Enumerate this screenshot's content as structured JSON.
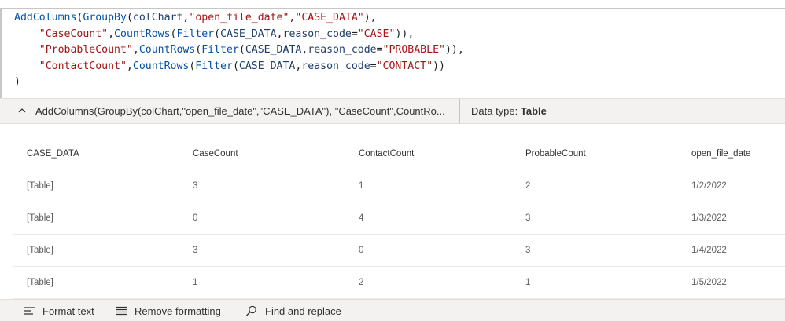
{
  "editor": {
    "lines": [
      [
        {
          "t": "AddColumns",
          "k": "fn"
        },
        {
          "t": "(",
          "k": "p"
        },
        {
          "t": "GroupBy",
          "k": "fn"
        },
        {
          "t": "(",
          "k": "p"
        },
        {
          "t": "colChart",
          "k": "id"
        },
        {
          "t": ",",
          "k": "p"
        },
        {
          "t": "\"open_file_date\"",
          "k": "str"
        },
        {
          "t": ",",
          "k": "p"
        },
        {
          "t": "\"CASE_DATA\"",
          "k": "str"
        },
        {
          "t": "),",
          "k": "p"
        }
      ],
      [
        {
          "t": "    ",
          "k": "p"
        },
        {
          "t": "\"CaseCount\"",
          "k": "str"
        },
        {
          "t": ",",
          "k": "p"
        },
        {
          "t": "CountRows",
          "k": "fn"
        },
        {
          "t": "(",
          "k": "p"
        },
        {
          "t": "Filter",
          "k": "fn"
        },
        {
          "t": "(",
          "k": "p"
        },
        {
          "t": "CASE_DATA",
          "k": "id"
        },
        {
          "t": ",",
          "k": "p"
        },
        {
          "t": "reason_code",
          "k": "id"
        },
        {
          "t": "=",
          "k": "p"
        },
        {
          "t": "\"CASE\"",
          "k": "str"
        },
        {
          "t": ")),",
          "k": "p"
        }
      ],
      [
        {
          "t": "    ",
          "k": "p"
        },
        {
          "t": "\"ProbableCount\"",
          "k": "str"
        },
        {
          "t": ",",
          "k": "p"
        },
        {
          "t": "CountRows",
          "k": "fn"
        },
        {
          "t": "(",
          "k": "p"
        },
        {
          "t": "Filter",
          "k": "fn"
        },
        {
          "t": "(",
          "k": "p"
        },
        {
          "t": "CASE_DATA",
          "k": "id"
        },
        {
          "t": ",",
          "k": "p"
        },
        {
          "t": "reason_code",
          "k": "id"
        },
        {
          "t": "=",
          "k": "p"
        },
        {
          "t": "\"PROBABLE\"",
          "k": "str"
        },
        {
          "t": ")),",
          "k": "p"
        }
      ],
      [
        {
          "t": "    ",
          "k": "p"
        },
        {
          "t": "\"ContactCount\"",
          "k": "str"
        },
        {
          "t": ",",
          "k": "p"
        },
        {
          "t": "CountRows",
          "k": "fn"
        },
        {
          "t": "(",
          "k": "p"
        },
        {
          "t": "Filter",
          "k": "fn"
        },
        {
          "t": "(",
          "k": "p"
        },
        {
          "t": "CASE_DATA",
          "k": "id"
        },
        {
          "t": ",",
          "k": "p"
        },
        {
          "t": "reason_code",
          "k": "id"
        },
        {
          "t": "=",
          "k": "p"
        },
        {
          "t": "\"CONTACT\"",
          "k": "str"
        },
        {
          "t": "))",
          "k": "p"
        }
      ],
      [
        {
          "t": ")",
          "k": "p"
        }
      ]
    ]
  },
  "result": {
    "chevron_icon": "chevron-up-icon",
    "formula_preview": "AddColumns(GroupBy(colChart,\"open_file_date\",\"CASE_DATA\"), \"CaseCount\",CountRo...",
    "datatype_label": "Data type: ",
    "datatype_value": "Table"
  },
  "table": {
    "columns": [
      "CASE_DATA",
      "CaseCount",
      "ContactCount",
      "ProbableCount",
      "open_file_date"
    ],
    "rows": [
      [
        "[Table]",
        "3",
        "1",
        "2",
        "1/2/2022"
      ],
      [
        "[Table]",
        "0",
        "4",
        "3",
        "1/3/2022"
      ],
      [
        "[Table]",
        "3",
        "0",
        "3",
        "1/4/2022"
      ],
      [
        "[Table]",
        "1",
        "2",
        "1",
        "1/5/2022"
      ]
    ]
  },
  "toolbar": {
    "format_text": "Format text",
    "format_text_icon": "format-text-icon",
    "remove_formatting": "Remove formatting",
    "remove_formatting_icon": "remove-formatting-icon",
    "find_replace": "Find and replace",
    "find_replace_icon": "search-icon"
  },
  "colors": {
    "function": "#0451a5",
    "string": "#a31515",
    "identifier": "#1f3d6b",
    "panel_bg": "#f3f2f1"
  }
}
